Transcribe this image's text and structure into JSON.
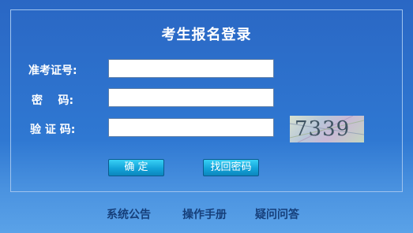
{
  "panel": {
    "title": "考生报名登录"
  },
  "form": {
    "exam_id_label": "准考证号:",
    "password_label": "密    码:",
    "captcha_label": "验 证 码:",
    "exam_id_value": "",
    "password_value": "",
    "captcha_value": "",
    "captcha_text": "7339"
  },
  "buttons": {
    "confirm": "确  定",
    "recover": "找回密码"
  },
  "footer": {
    "announcement": "系统公告",
    "manual": "操作手册",
    "faq": "疑问问答"
  }
}
